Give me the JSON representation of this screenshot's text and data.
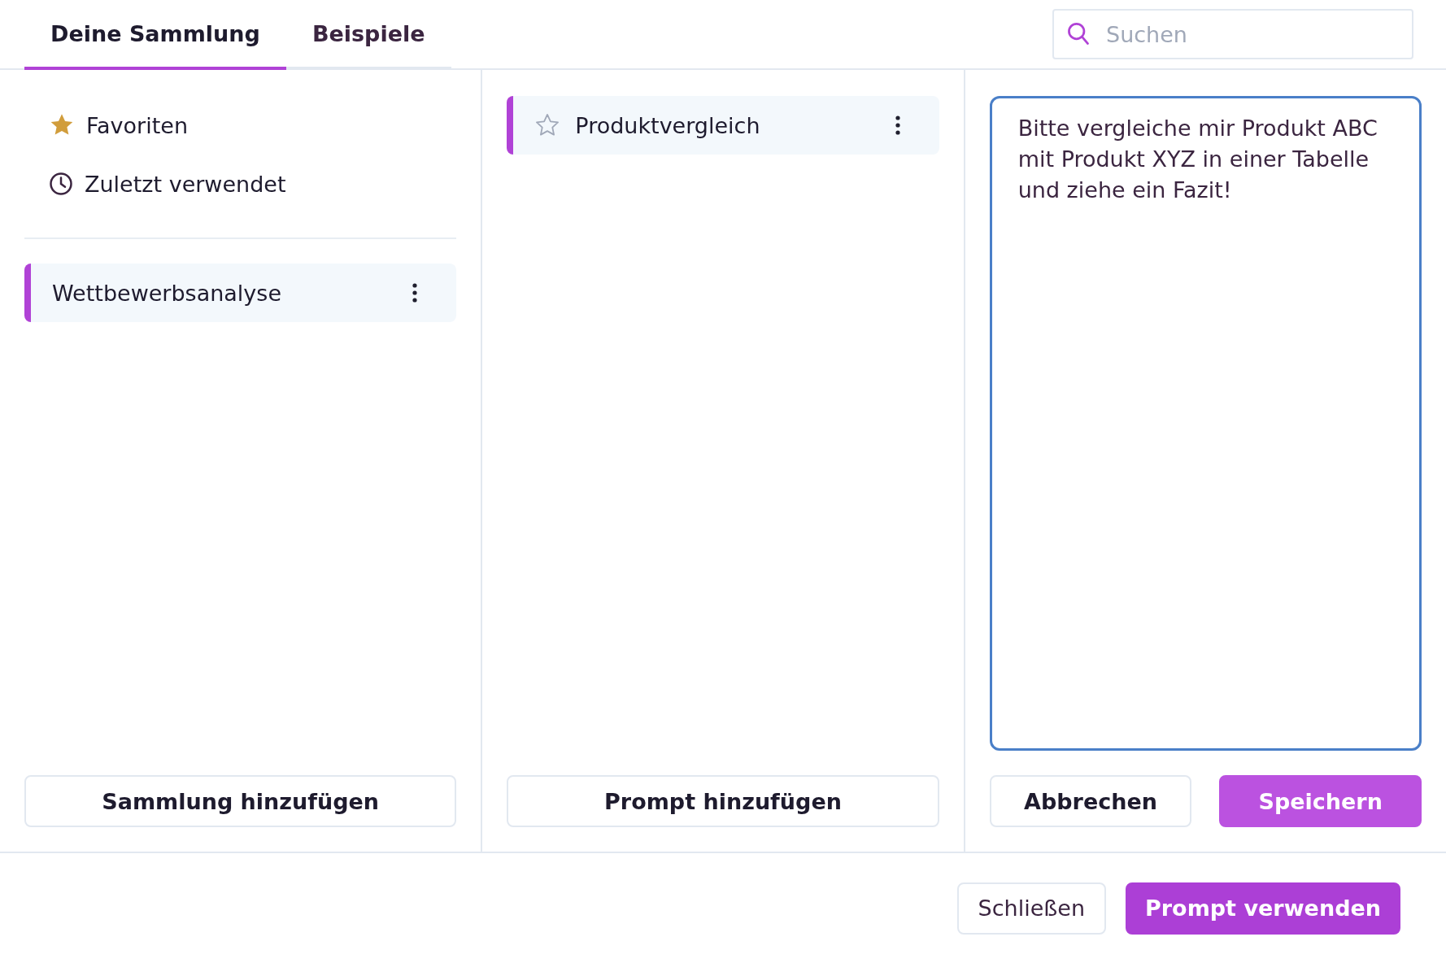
{
  "tabs": [
    {
      "label": "Deine Sammlung",
      "selected": true
    },
    {
      "label": "Beispiele",
      "selected": false
    }
  ],
  "search": {
    "placeholder": "Suchen"
  },
  "sidebar": {
    "nav": [
      {
        "kind": "favorites",
        "label": "Favoriten"
      },
      {
        "kind": "recent",
        "label": "Zuletzt verwendet"
      }
    ],
    "collections": [
      {
        "name": "Wettbewerbsanalyse",
        "selected": true
      }
    ],
    "add_button": "Sammlung hinzufügen"
  },
  "prompts": {
    "items": [
      {
        "name": "Produktvergleich",
        "favorite": false,
        "selected": true
      }
    ],
    "add_button": "Prompt hinzufügen"
  },
  "editor": {
    "value": "Bitte vergleiche mir Produkt ABC mit Produkt XYZ in einer Tabelle und ziehe ein Fazit!",
    "cancel_button": "Abbrechen",
    "save_button": "Speichern"
  },
  "footer": {
    "close_button": "Schließen",
    "use_button": "Prompt verwenden"
  }
}
